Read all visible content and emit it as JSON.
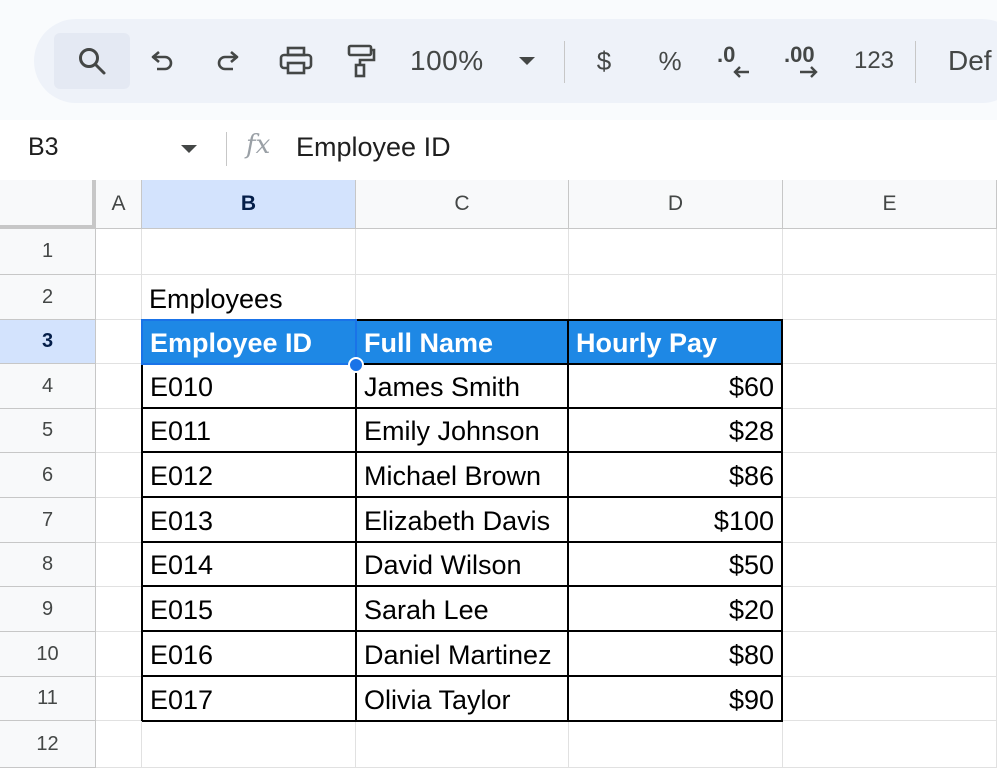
{
  "toolbar": {
    "zoom": "100%",
    "currency": "$",
    "percent": "%",
    "decrease_decimal": ".0",
    "increase_decimal": ".00",
    "number_format": "123",
    "font": "Def"
  },
  "formula_bar": {
    "cell_ref": "B3",
    "fx": "fx",
    "value": "Employee ID"
  },
  "grid": {
    "columns": [
      "A",
      "B",
      "C",
      "D",
      "E"
    ],
    "rows": [
      "1",
      "2",
      "3",
      "4",
      "5",
      "6",
      "7",
      "8",
      "9",
      "10",
      "11",
      "12"
    ],
    "selected_column": "B",
    "selected_row": "3",
    "title": "Employees",
    "table": {
      "headers": [
        "Employee ID",
        "Full Name",
        "Hourly Pay"
      ],
      "rows": [
        [
          "E010",
          "James Smith",
          "$60"
        ],
        [
          "E011",
          "Emily Johnson",
          "$28"
        ],
        [
          "E012",
          "Michael Brown",
          "$86"
        ],
        [
          "E013",
          "Elizabeth Davis",
          "$100"
        ],
        [
          "E014",
          "David Wilson",
          "$50"
        ],
        [
          "E015",
          "Sarah Lee",
          "$20"
        ],
        [
          "E016",
          "Daniel Martinez",
          "$80"
        ],
        [
          "E017",
          "Olivia Taylor",
          "$90"
        ]
      ]
    }
  },
  "colors": {
    "header_fill": "#1e88e5",
    "selection": "#1a73e8",
    "selected_header": "#d3e3fd"
  }
}
